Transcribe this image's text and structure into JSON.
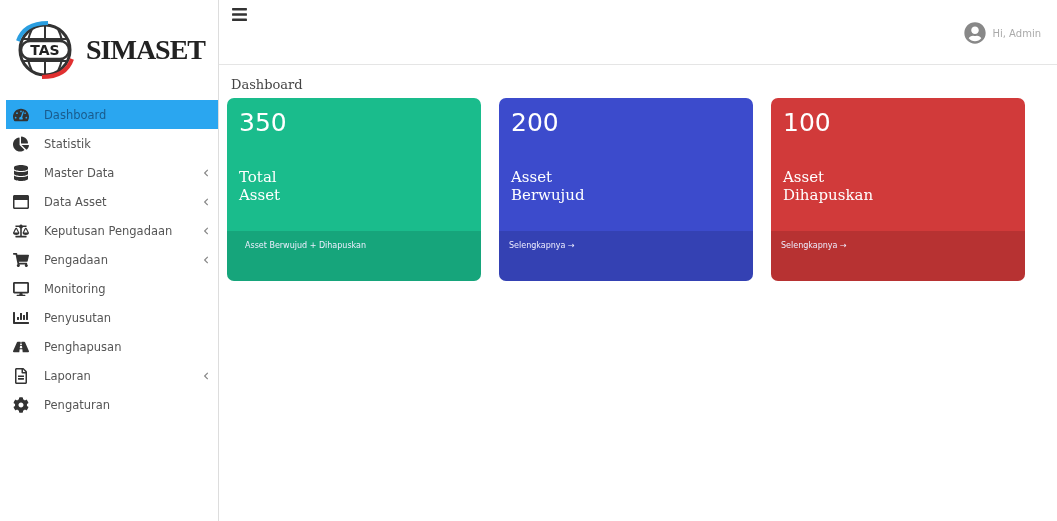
{
  "logo": {
    "badge": "TAS",
    "name": "SIMASET"
  },
  "sidebar": {
    "items": [
      {
        "label": "Dashboard",
        "selected": true,
        "expandable": false
      },
      {
        "label": "Statistik",
        "selected": false,
        "expandable": false
      },
      {
        "label": "Master Data",
        "selected": false,
        "expandable": true
      },
      {
        "label": "Data Asset",
        "selected": false,
        "expandable": true
      },
      {
        "label": "Keputusan Pengadaan",
        "selected": false,
        "expandable": true
      },
      {
        "label": "Pengadaan",
        "selected": false,
        "expandable": true
      },
      {
        "label": "Monitoring",
        "selected": false,
        "expandable": false
      },
      {
        "label": "Penyusutan",
        "selected": false,
        "expandable": false
      },
      {
        "label": "Penghapusan",
        "selected": false,
        "expandable": false
      },
      {
        "label": "Laporan",
        "selected": false,
        "expandable": true
      },
      {
        "label": "Pengaturan",
        "selected": false,
        "expandable": false
      }
    ]
  },
  "header": {
    "user": "Hi, Admin"
  },
  "page_title": "Dashboard",
  "cards": [
    {
      "value": "350",
      "label": "Total\nAsset",
      "link": "Asset Berwujud + Dihapuskan",
      "color": "#1abc8c"
    },
    {
      "value": "200",
      "label": "Asset\nBerwujud",
      "link": "Selengkapnya →",
      "color": "#3c4bcc"
    },
    {
      "value": "100",
      "label": "Asset\nDihapuskan",
      "link": "Selengkapnya →",
      "color": "#d13a3a"
    }
  ]
}
